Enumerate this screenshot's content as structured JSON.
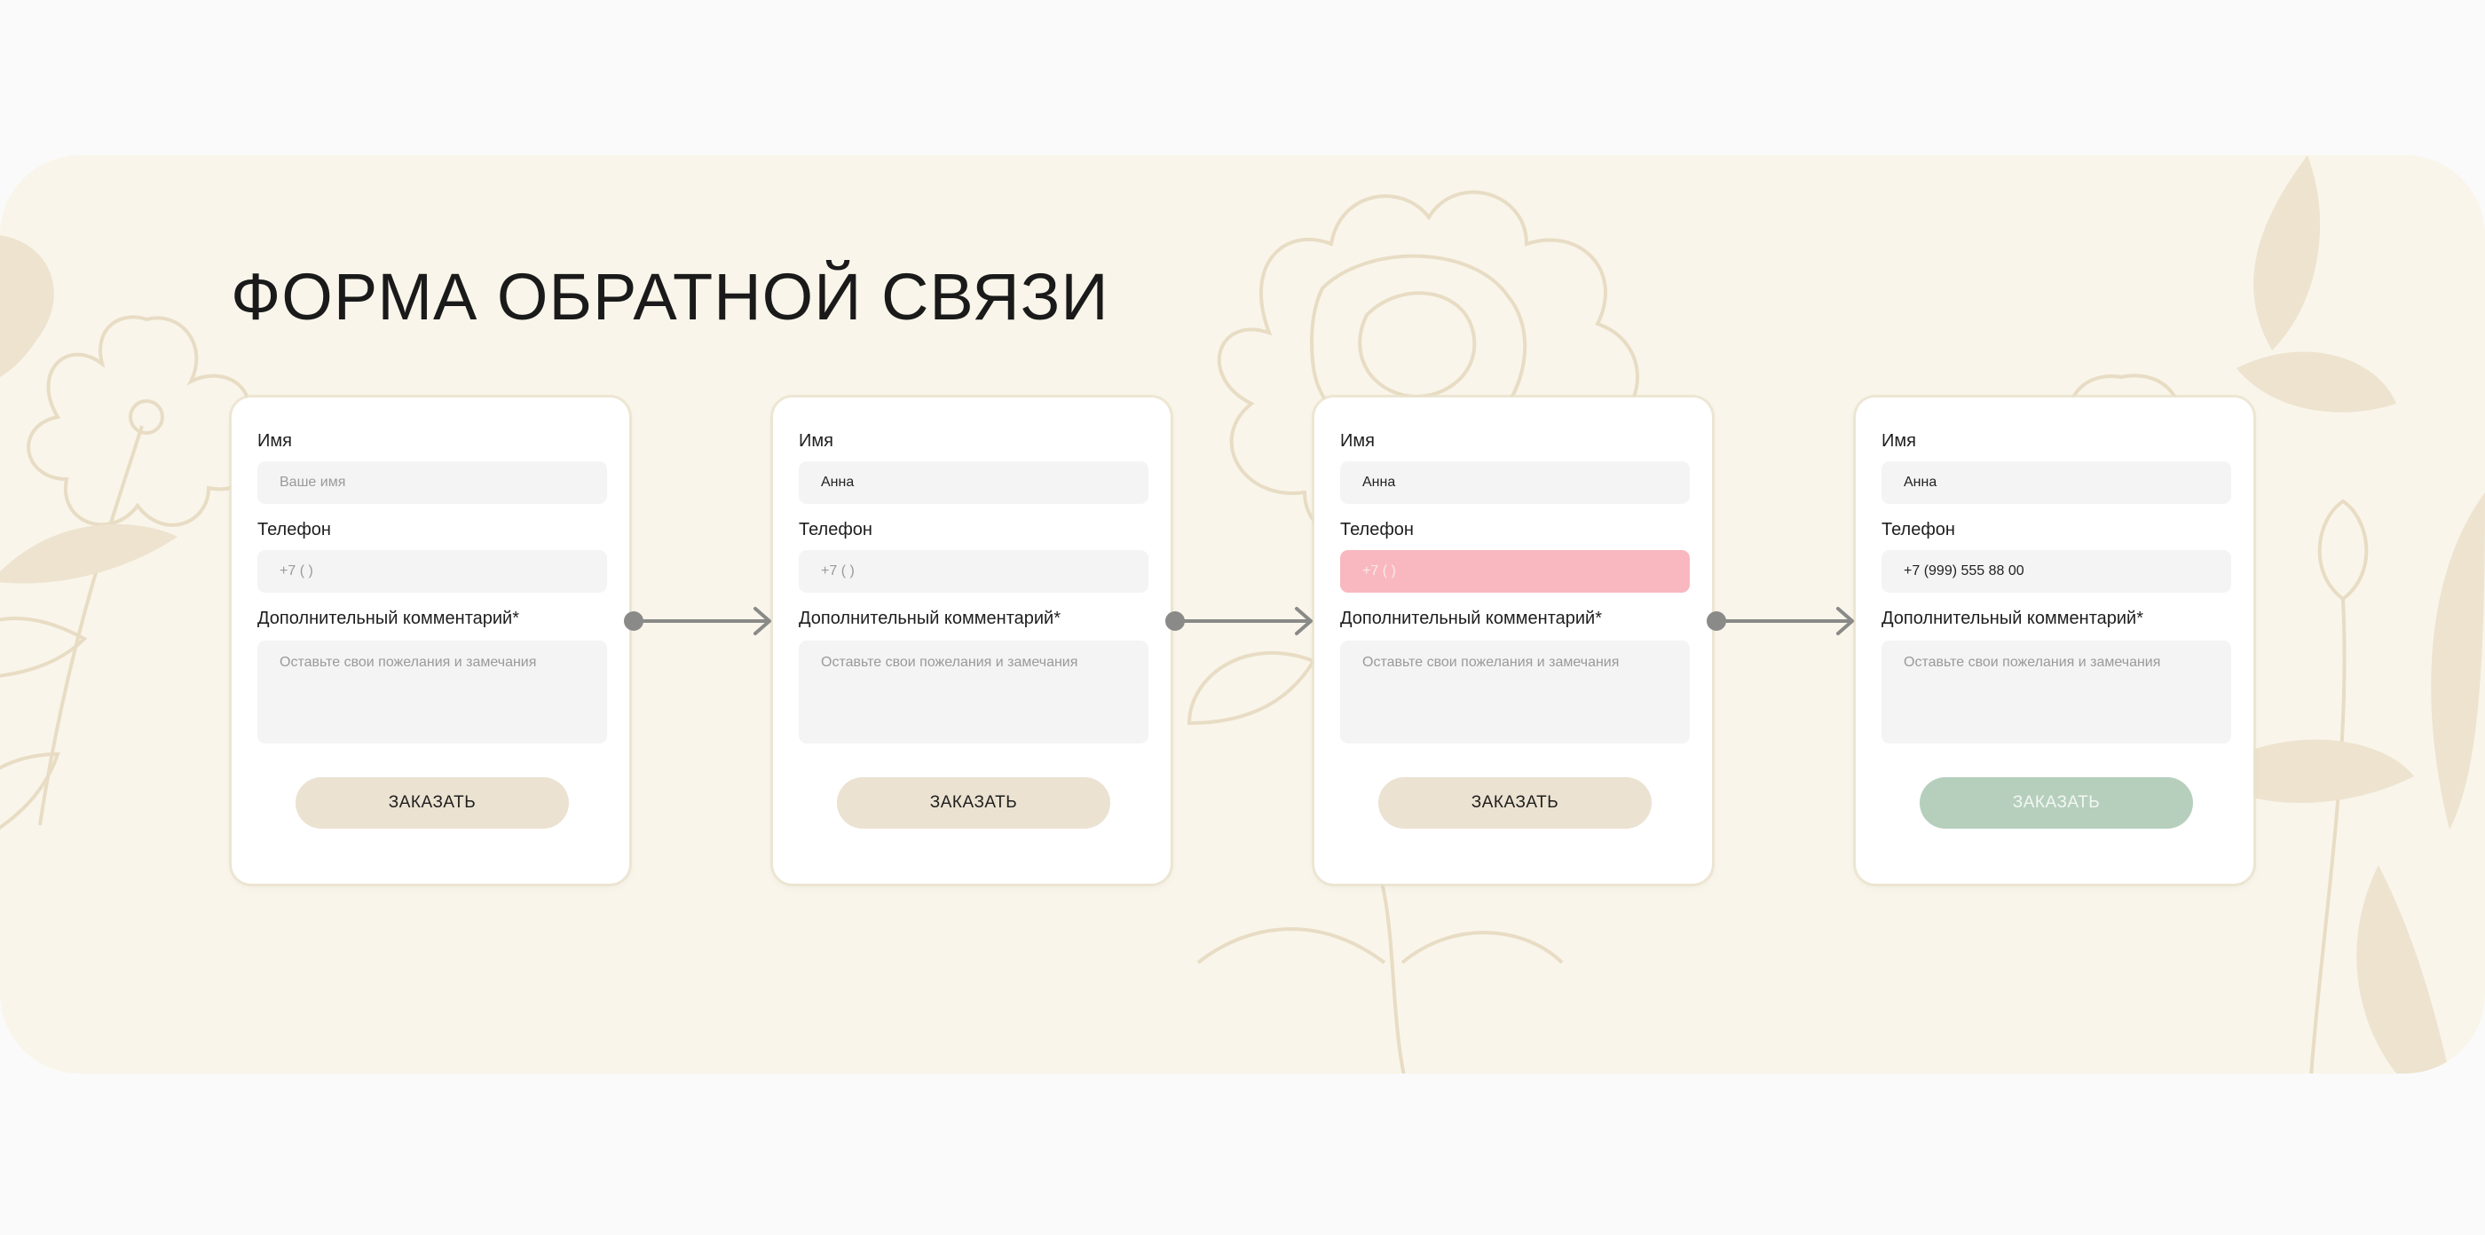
{
  "page": {
    "title": "ФОРМА ОБРАТНОЙ СВЯЗИ"
  },
  "colors": {
    "panel_bg": "#f9f5ea",
    "floral": "#ede3cf",
    "field_bg": "#f4f4f4",
    "error_field": "#f9b8bf",
    "button_default": "#ebe2d1",
    "button_success": "#b6cfbd",
    "connector": "#8a8a88"
  },
  "icons": {
    "connector": "arrow-right-icon",
    "dot": "dot-icon"
  },
  "forms": [
    {
      "state": "empty",
      "name_label": "Имя",
      "name_value": "Ваше имя",
      "phone_label": "Телефон",
      "phone_value": "+7 (    )",
      "comment_label": "Дополнительный комментарий*",
      "comment_placeholder": "Оставьте свои пожелания и замечания",
      "submit_label": "ЗАКАЗАТЬ"
    },
    {
      "state": "name-filled",
      "name_label": "Имя",
      "name_value": "Анна",
      "phone_label": "Телефон",
      "phone_value": "+7 (    )",
      "comment_label": "Дополнительный комментарий*",
      "comment_placeholder": "Оставьте свои пожелания и замечания",
      "submit_label": "ЗАКАЗАТЬ"
    },
    {
      "state": "phone-error",
      "name_label": "Имя",
      "name_value": "Анна",
      "phone_label": "Телефон",
      "phone_value": "+7 (    )",
      "comment_label": "Дополнительный комментарий*",
      "comment_placeholder": "Оставьте свои пожелания и замечания",
      "submit_label": "ЗАКАЗАТЬ"
    },
    {
      "state": "completed",
      "name_label": "Имя",
      "name_value": "Анна",
      "phone_label": "Телефон",
      "phone_value": "+7 (999) 555 88 00",
      "comment_label": "Дополнительный комментарий*",
      "comment_placeholder": "Оставьте свои пожелания и замечания",
      "submit_label": "ЗАКАЗАТЬ"
    }
  ]
}
